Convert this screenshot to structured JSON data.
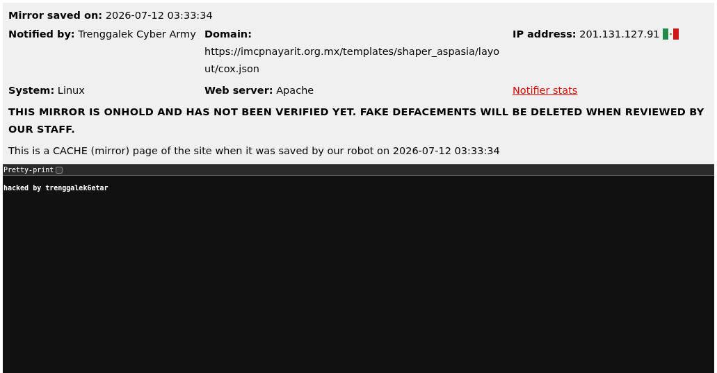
{
  "mirror_saved": {
    "label": "Mirror saved on:",
    "value": "2026-07-12 03:33:34"
  },
  "fields": [
    {
      "kind": "text",
      "label": "Notified by:",
      "value": "Trenggalek Cyber Army"
    },
    {
      "kind": "url",
      "label": "Domain:",
      "value": "https://imcpnayarit.org.mx/templates/shaper_aspasia/layout/cox.json"
    },
    {
      "kind": "ip",
      "label": "IP address:",
      "value": "201.131.127.91"
    },
    {
      "kind": "text",
      "label": "System:",
      "value": "Linux"
    },
    {
      "kind": "text",
      "label": "Web server:",
      "value": "Apache"
    },
    {
      "kind": "link",
      "value": "Notifier stats"
    }
  ],
  "warning": "THIS MIRROR IS ONHOLD AND HAS NOT BEEN VERIFIED YET. FAKE DEFACEMENTS WILL BE DELETED WHEN REVIEWED BY OUR STAFF.",
  "cache_note": "This is a CACHE (mirror) page of the site when it was saved by our robot on 2026-07-12 03:33:34",
  "viewer": {
    "toggle_label": "Pretty-print",
    "checked": false,
    "content": "hacked by trenggalek6etar"
  }
}
